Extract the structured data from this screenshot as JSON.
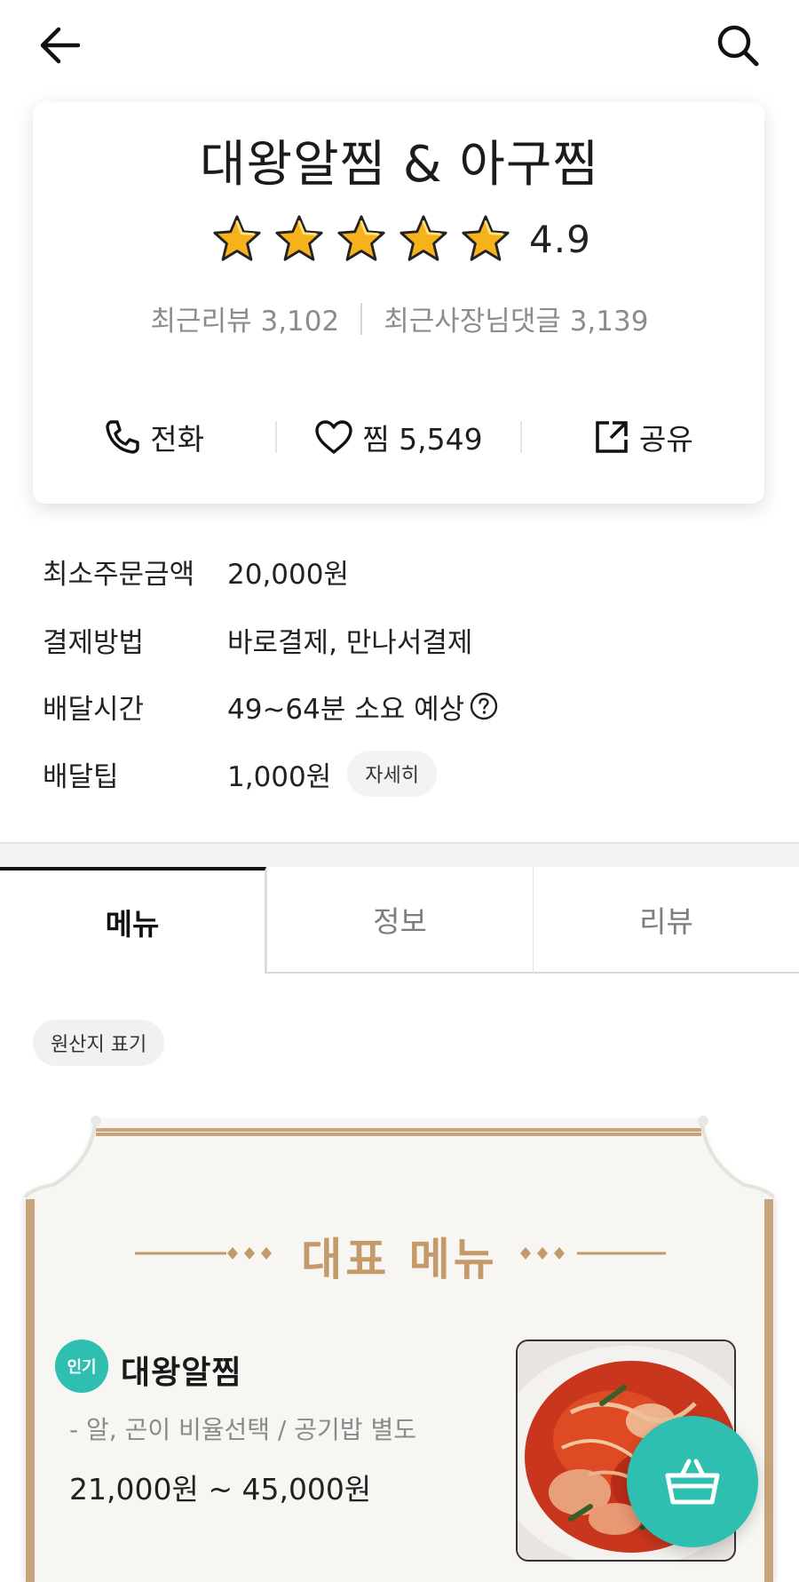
{
  "header": {
    "back_icon": "arrow-left-icon",
    "search_icon": "search-icon"
  },
  "store": {
    "name": "대왕알찜 & 아구찜",
    "rating": "4.9",
    "rating_stars": 5,
    "recent_reviews": "최근리뷰 3,102",
    "recent_owner_replies": "최근사장님댓글 3,139"
  },
  "actions": {
    "call_label": "전화",
    "like_label": "찜 5,549",
    "share_label": "공유"
  },
  "info": {
    "min_order_label": "최소주문금액",
    "min_order_value": "20,000원",
    "payment_label": "결제방법",
    "payment_value": "바로결제, 만나서결제",
    "delivery_time_label": "배달시간",
    "delivery_time_value": "49~64분 소요 예상",
    "delivery_tip_label": "배달팁",
    "delivery_tip_value": "1,000원",
    "detail_button": "자세히"
  },
  "tabs": [
    {
      "label": "메뉴",
      "active": true
    },
    {
      "label": "정보",
      "active": false
    },
    {
      "label": "리뷰",
      "active": false
    }
  ],
  "origin_chip": "원산지 표기",
  "featured": {
    "section_title": "대표 메뉴",
    "badge": "인기",
    "item_name": "대왕알찜",
    "item_desc": "- 알, 곤이 비율선택 / 공기밥 별도",
    "item_price": "21,000원 ~ 45,000원"
  },
  "colors": {
    "accent_teal": "#2fbfb1",
    "board_gold": "#c59a6a",
    "star_yellow": "#f6b21b"
  },
  "cart_icon": "shopping-basket-icon"
}
